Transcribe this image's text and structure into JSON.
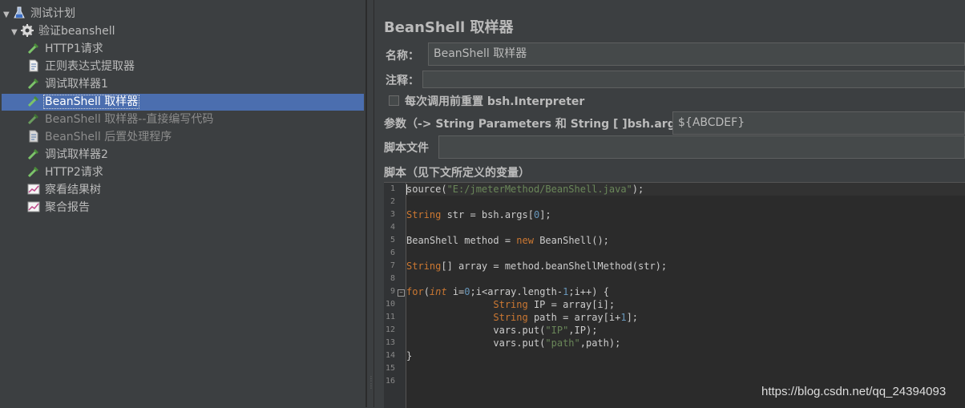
{
  "tree": {
    "items": [
      {
        "label": "测试计划",
        "icon": "flask-icon"
      },
      {
        "label": "验证beanshell",
        "icon": "gear-icon"
      },
      {
        "label": "HTTP1请求",
        "icon": "pipette-icon"
      },
      {
        "label": "正则表达式提取器",
        "icon": "document-icon"
      },
      {
        "label": "调试取样器1",
        "icon": "pipette-icon"
      },
      {
        "label": "BeanShell 取样器",
        "icon": "pipette-icon"
      },
      {
        "label": "BeanShell 取样器--直接编写代码",
        "icon": "pipette-icon"
      },
      {
        "label": "BeanShell 后置处理程序",
        "icon": "document-icon"
      },
      {
        "label": "调试取样器2",
        "icon": "pipette-icon"
      },
      {
        "label": "HTTP2请求",
        "icon": "pipette-icon"
      },
      {
        "label": "察看结果树",
        "icon": "graph-icon"
      },
      {
        "label": "聚合报告",
        "icon": "graph-icon"
      }
    ]
  },
  "panel": {
    "title": "BeanShell 取样器",
    "name_label": "名称：",
    "name_value": "BeanShell 取样器",
    "comment_label": "注释：",
    "comment_value": "",
    "reset_label": "每次调用前重置 bsh.Interpreter",
    "params_label": "参数（-> String Parameters 和 String [ ]bsh.args）",
    "params_value": "${ABCDEF}",
    "script_file_label": "脚本文件",
    "script_file_value": "",
    "script_label": "脚本（见下文所定义的变量）"
  },
  "editor": {
    "line_numbers": [
      "1",
      "2",
      "3",
      "4",
      "5",
      "6",
      "7",
      "8",
      "9",
      "10",
      "11",
      "12",
      "13",
      "14",
      "15",
      "16"
    ],
    "lines": [
      "source(\"E:/jmeterMethod/BeanShell.java\");",
      "",
      "String str = bsh.args[0];",
      "",
      "BeanShell method = new BeanShell();",
      "",
      "String[] array = method.beanShellMethod(str);",
      "",
      "for(int i=0;i<array.length-1;i++) {",
      "               String IP = array[i];",
      "               String path = array[i+1];",
      "               vars.put(\"IP\",IP);",
      "               vars.put(\"path\",path);",
      "}",
      "",
      ""
    ]
  },
  "watermark": "https://blog.csdn.net/qq_24394093",
  "colors": {
    "selection": "#4b6eaf",
    "background": "#3c3f41",
    "editor_bg": "#2b2b2b",
    "keyword": "#cc7832",
    "string": "#6a8759",
    "number": "#6897bb"
  }
}
